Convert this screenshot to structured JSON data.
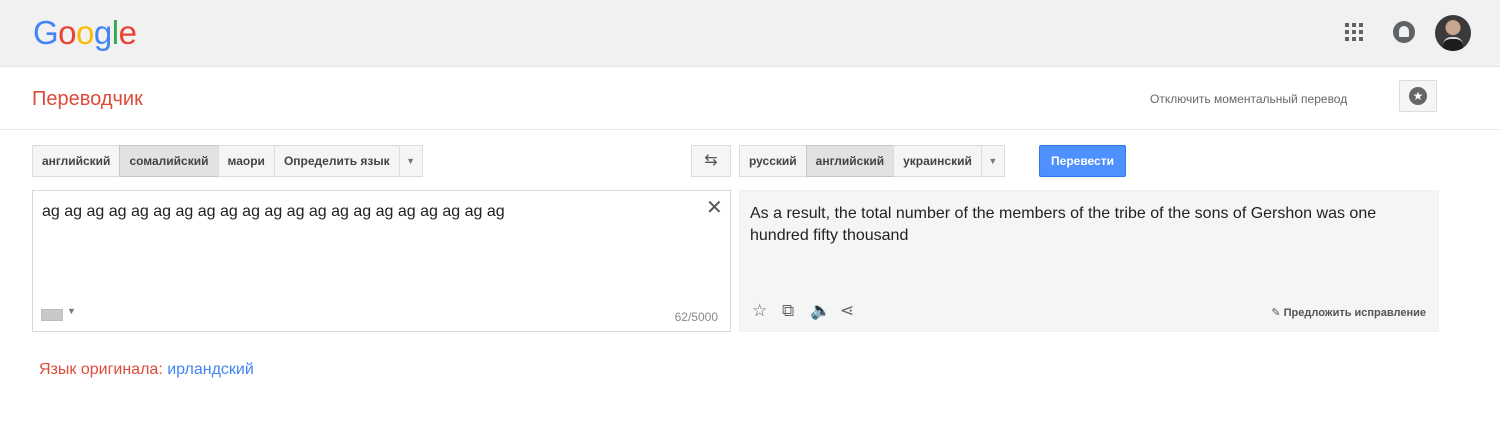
{
  "logo": {
    "g1": "G",
    "o1": "o",
    "o2": "o",
    "g2": "g",
    "l": "l",
    "e": "e"
  },
  "icons": {
    "apps": "apps-grid-icon",
    "notifications": "notifications-icon",
    "star": "star-icon",
    "swap": "swap-icon",
    "clear": "close-icon",
    "keyboard": "keyboard-icon",
    "copy": "copy-icon",
    "speaker": "speaker-icon",
    "share": "share-icon",
    "pencil": "pencil-icon"
  },
  "header": {
    "title": "Переводчик",
    "instant_toggle": "Отключить моментальный перевод"
  },
  "source_langs": {
    "items": [
      "английский",
      "сомалийский",
      "маори",
      "Определить язык"
    ],
    "active_index": 1
  },
  "target_langs": {
    "items": [
      "русский",
      "английский",
      "украинский"
    ],
    "active_index": 1
  },
  "swap_glyph": "⇆",
  "translate_button": "Перевести",
  "source": {
    "text": "ag ag ag ag ag ag ag ag ag ag ag ag ag ag ag ag ag ag ag ag ag",
    "char_count": "62/5000"
  },
  "result": {
    "text": "As a result, the total number of the members of the tribe of the sons of Gershon was one hundred fifty thousand",
    "suggest": "Предложить исправление"
  },
  "detected": {
    "label": "Язык оригинала:",
    "value": "ирландский"
  },
  "colors": {
    "accent_red": "#dd4b39",
    "link_blue": "#4285f4",
    "button_blue": "#4d90fe"
  }
}
